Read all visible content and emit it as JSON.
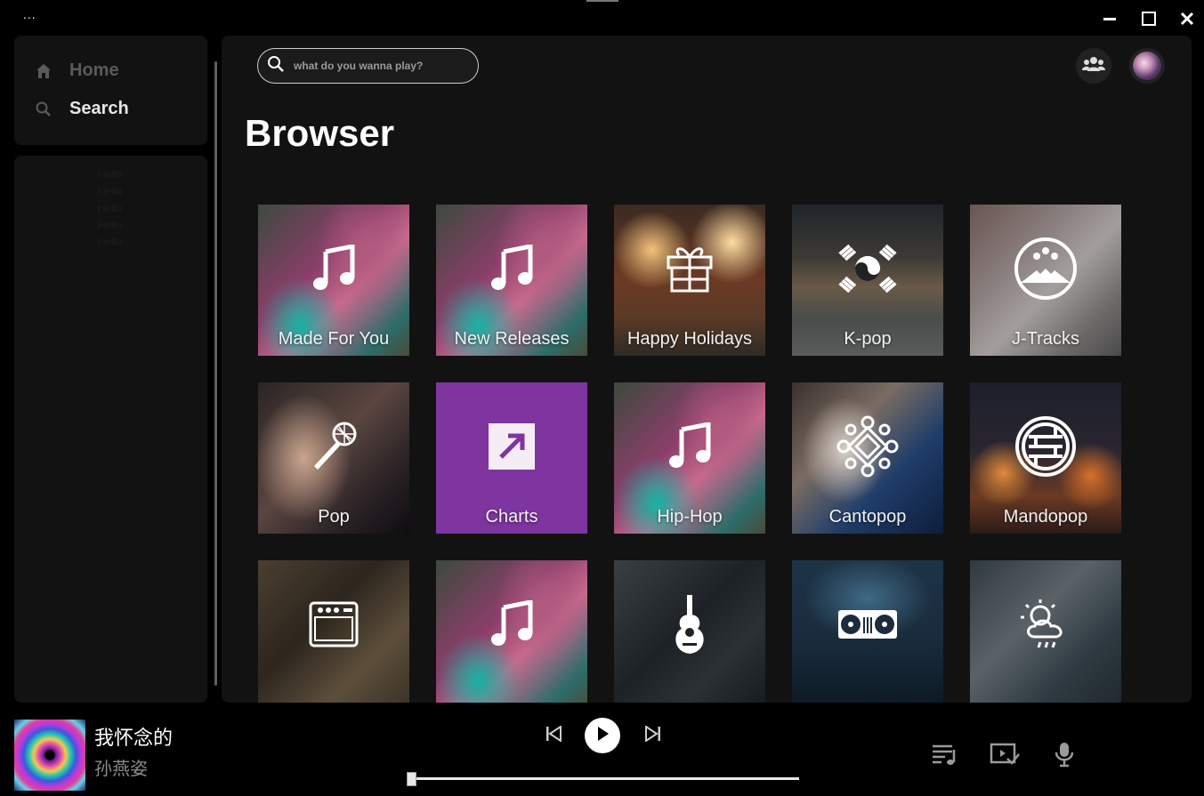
{
  "titlebar": {
    "menu_label": "...",
    "icons": {
      "minimize": "minimize-icon",
      "maximize": "maximize-icon",
      "close": "close-icon"
    }
  },
  "sidebar": {
    "nav": [
      {
        "label": "Home",
        "icon": "home-icon"
      },
      {
        "label": "Search",
        "icon": "search-icon"
      }
    ],
    "library": [
      "Hello",
      "Hello",
      "Hello",
      "Hello",
      "Hello"
    ]
  },
  "header": {
    "search_placeholder": "what do you wanna play?",
    "friends_icon": "friends-icon",
    "avatar_icon": "avatar"
  },
  "main": {
    "title": "Browser",
    "tiles": [
      {
        "label": "Made For You",
        "icon": "music-note-icon"
      },
      {
        "label": "New Releases",
        "icon": "music-note-icon"
      },
      {
        "label": "Happy Holidays",
        "icon": "gift-icon"
      },
      {
        "label": "K-pop",
        "icon": "taegeuk-flag-icon"
      },
      {
        "label": "J-Tracks",
        "icon": "mount-fuji-icon"
      },
      {
        "label": "Pop",
        "icon": "microphone-icon"
      },
      {
        "label": "Charts",
        "icon": "trending-arrow-icon",
        "color": "#7e35a0"
      },
      {
        "label": "Hip-Hop",
        "icon": "music-note-icon"
      },
      {
        "label": "Cantopop",
        "icon": "endless-knot-icon"
      },
      {
        "label": "Mandopop",
        "icon": "chinese-shou-symbol-icon"
      },
      {
        "label": "",
        "icon": "amplifier-icon"
      },
      {
        "label": "",
        "icon": "music-note-icon"
      },
      {
        "label": "",
        "icon": "guitar-icon"
      },
      {
        "label": "",
        "icon": "turntable-icon"
      },
      {
        "label": "",
        "icon": "weather-icon"
      }
    ]
  },
  "player": {
    "title": "我怀念的",
    "artist": "孙燕姿",
    "progress": 0.0,
    "controls": {
      "prev": "previous-icon",
      "play": "play-icon",
      "next": "next-icon"
    },
    "aux": {
      "queue": "queue-icon",
      "devices": "connect-devices-icon",
      "mic": "microphone-icon"
    }
  }
}
